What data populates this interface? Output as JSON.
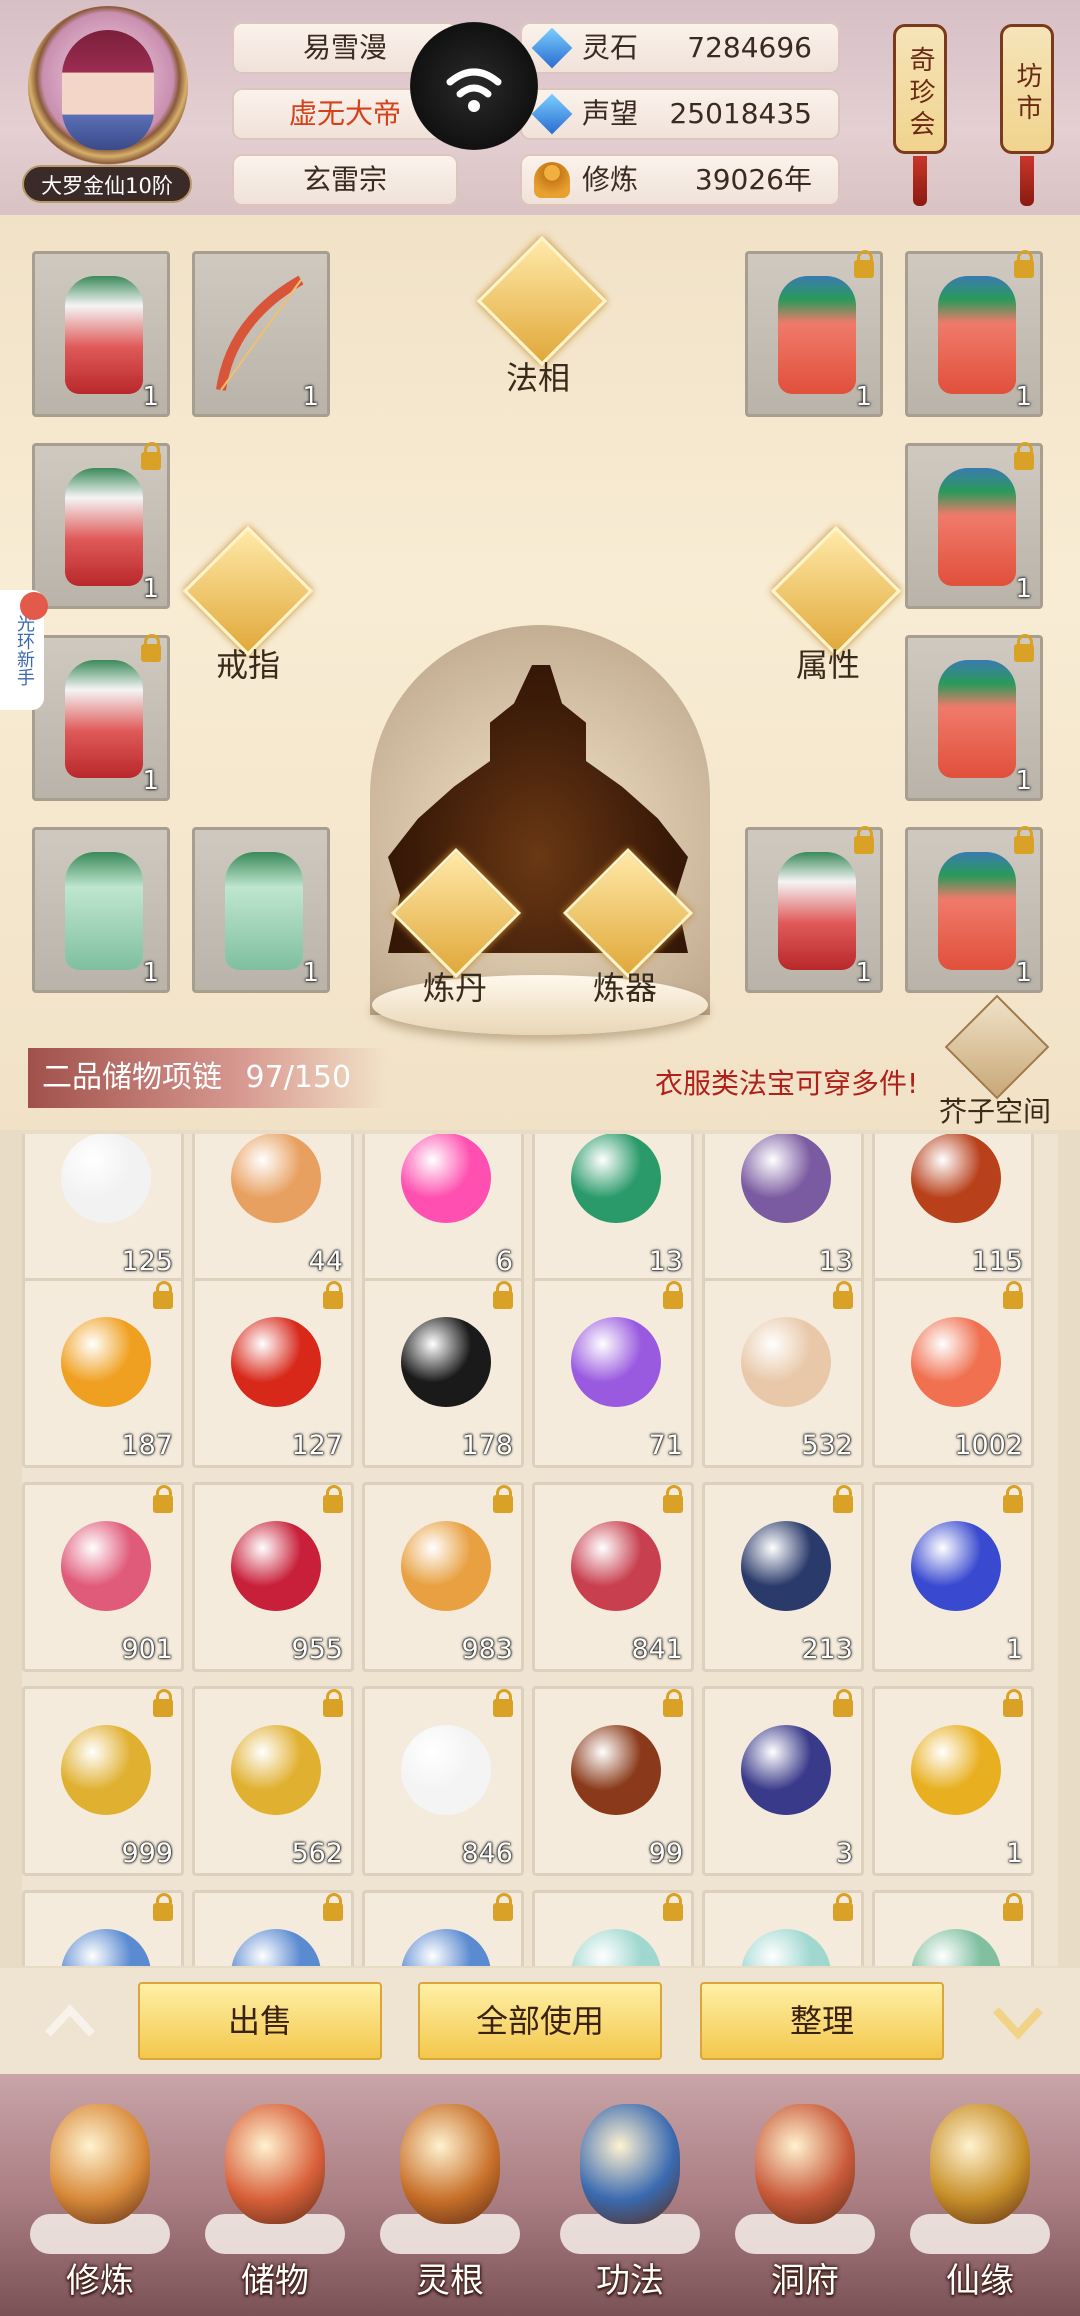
{
  "player": {
    "name": "易雪漫",
    "title": "虚无大帝",
    "sect": "玄雷宗",
    "realm": "大罗金仙10阶"
  },
  "stats": [
    {
      "key": "灵石",
      "value": "7284696",
      "icon": "spirit-stone-icon"
    },
    {
      "key": "声望",
      "value": "25018435",
      "icon": "prestige-gem-icon"
    },
    {
      "key": "修炼",
      "value": "39026年",
      "icon": "meditation-icon"
    }
  ],
  "shops": [
    {
      "label": "奇珍会"
    },
    {
      "label": "坊市"
    }
  ],
  "side_tab": {
    "label": "光环新手"
  },
  "equip": {
    "left_slots": [
      {
        "count": "1",
        "locked": false,
        "color": "#e05a5a"
      },
      {
        "count": "1",
        "locked": false,
        "color": "#d8553a"
      },
      {
        "count": "1",
        "locked": true,
        "color": "#e05a5a"
      },
      {
        "count": "1",
        "locked": true,
        "color": "#e05a5a"
      },
      {
        "count": "1",
        "locked": false,
        "color": "#7fbfa0"
      },
      {
        "count": "1",
        "locked": false,
        "color": "#7fbfa0"
      }
    ],
    "right_slots": [
      {
        "count": "1",
        "locked": true,
        "color": "#f07a6a"
      },
      {
        "count": "1",
        "locked": true,
        "color": "#f07a6a"
      },
      {
        "count": "1",
        "locked": true,
        "color": "#f07a6a"
      },
      {
        "count": "1",
        "locked": true,
        "color": "#f07a6a"
      },
      {
        "count": "1",
        "locked": true,
        "color": "#e05a5a"
      },
      {
        "count": "1",
        "locked": true,
        "color": "#f07a6a"
      }
    ],
    "functions": {
      "faxiang": "法相",
      "ring": "戒指",
      "attribute": "属性",
      "alchemy": "炼丹",
      "forge": "炼器"
    }
  },
  "storage": {
    "name": "二品储物项链",
    "capacity": "97/150",
    "tip": "衣服类法宝可穿多件!",
    "space_label": "芥子空间"
  },
  "bag": {
    "rows": [
      [
        {
          "count": "125",
          "locked": false,
          "color": "#f2f2f2"
        },
        {
          "count": "44",
          "locked": false,
          "color": "#e8a060"
        },
        {
          "count": "6",
          "locked": false,
          "color": "#ff4fb0"
        },
        {
          "count": "13",
          "locked": false,
          "color": "#2a9a6a"
        },
        {
          "count": "13",
          "locked": false,
          "color": "#7a5aa0"
        },
        {
          "count": "115",
          "locked": false,
          "color": "#b8401a"
        }
      ],
      [
        {
          "count": "187",
          "locked": true,
          "color": "#f0a020"
        },
        {
          "count": "127",
          "locked": true,
          "color": "#d8281a"
        },
        {
          "count": "178",
          "locked": true,
          "color": "#1a1a1a"
        },
        {
          "count": "71",
          "locked": true,
          "color": "#9a5ae0"
        },
        {
          "count": "532",
          "locked": true,
          "color": "#e8c8a8"
        },
        {
          "count": "1002",
          "locked": true,
          "color": "#f07050"
        }
      ],
      [
        {
          "count": "901",
          "locked": true,
          "color": "#e05a7a"
        },
        {
          "count": "955",
          "locked": true,
          "color": "#c8203a"
        },
        {
          "count": "983",
          "locked": true,
          "color": "#e8a040"
        },
        {
          "count": "841",
          "locked": true,
          "color": "#c84050"
        },
        {
          "count": "213",
          "locked": true,
          "color": "#2a3a6a"
        },
        {
          "count": "1",
          "locked": true,
          "color": "#3a4ad0"
        }
      ],
      [
        {
          "count": "999",
          "locked": true,
          "color": "#e0b030"
        },
        {
          "count": "562",
          "locked": true,
          "color": "#e0b030"
        },
        {
          "count": "846",
          "locked": true,
          "color": "#f4f4f4"
        },
        {
          "count": "99",
          "locked": true,
          "color": "#8a3a1a"
        },
        {
          "count": "3",
          "locked": true,
          "color": "#3a3a8a"
        },
        {
          "count": "1",
          "locked": true,
          "color": "#e8b020"
        }
      ],
      [
        {
          "count": "",
          "locked": true,
          "color": "#5a8ad0"
        },
        {
          "count": "",
          "locked": true,
          "color": "#5a8ad0"
        },
        {
          "count": "",
          "locked": true,
          "color": "#5a8ad0"
        },
        {
          "count": "",
          "locked": true,
          "color": "#a0d8d0"
        },
        {
          "count": "",
          "locked": true,
          "color": "#a0d8d0"
        },
        {
          "count": "",
          "locked": true,
          "color": "#80c0a0"
        }
      ]
    ]
  },
  "actions": {
    "sell": "出售",
    "use_all": "全部使用",
    "sort": "整理"
  },
  "nav": [
    {
      "label": "修炼",
      "icon": "cultivate-icon",
      "color": "#d88a3a"
    },
    {
      "label": "储物",
      "icon": "storage-bag-icon",
      "color": "#d8603a"
    },
    {
      "label": "灵根",
      "icon": "spirit-root-icon",
      "color": "#c8702a"
    },
    {
      "label": "功法",
      "icon": "technique-book-icon",
      "color": "#3a6ab0"
    },
    {
      "label": "洞府",
      "icon": "cave-mansion-icon",
      "color": "#c85a3a"
    },
    {
      "label": "仙缘",
      "icon": "fate-gourd-icon",
      "color": "#c8902a"
    }
  ]
}
